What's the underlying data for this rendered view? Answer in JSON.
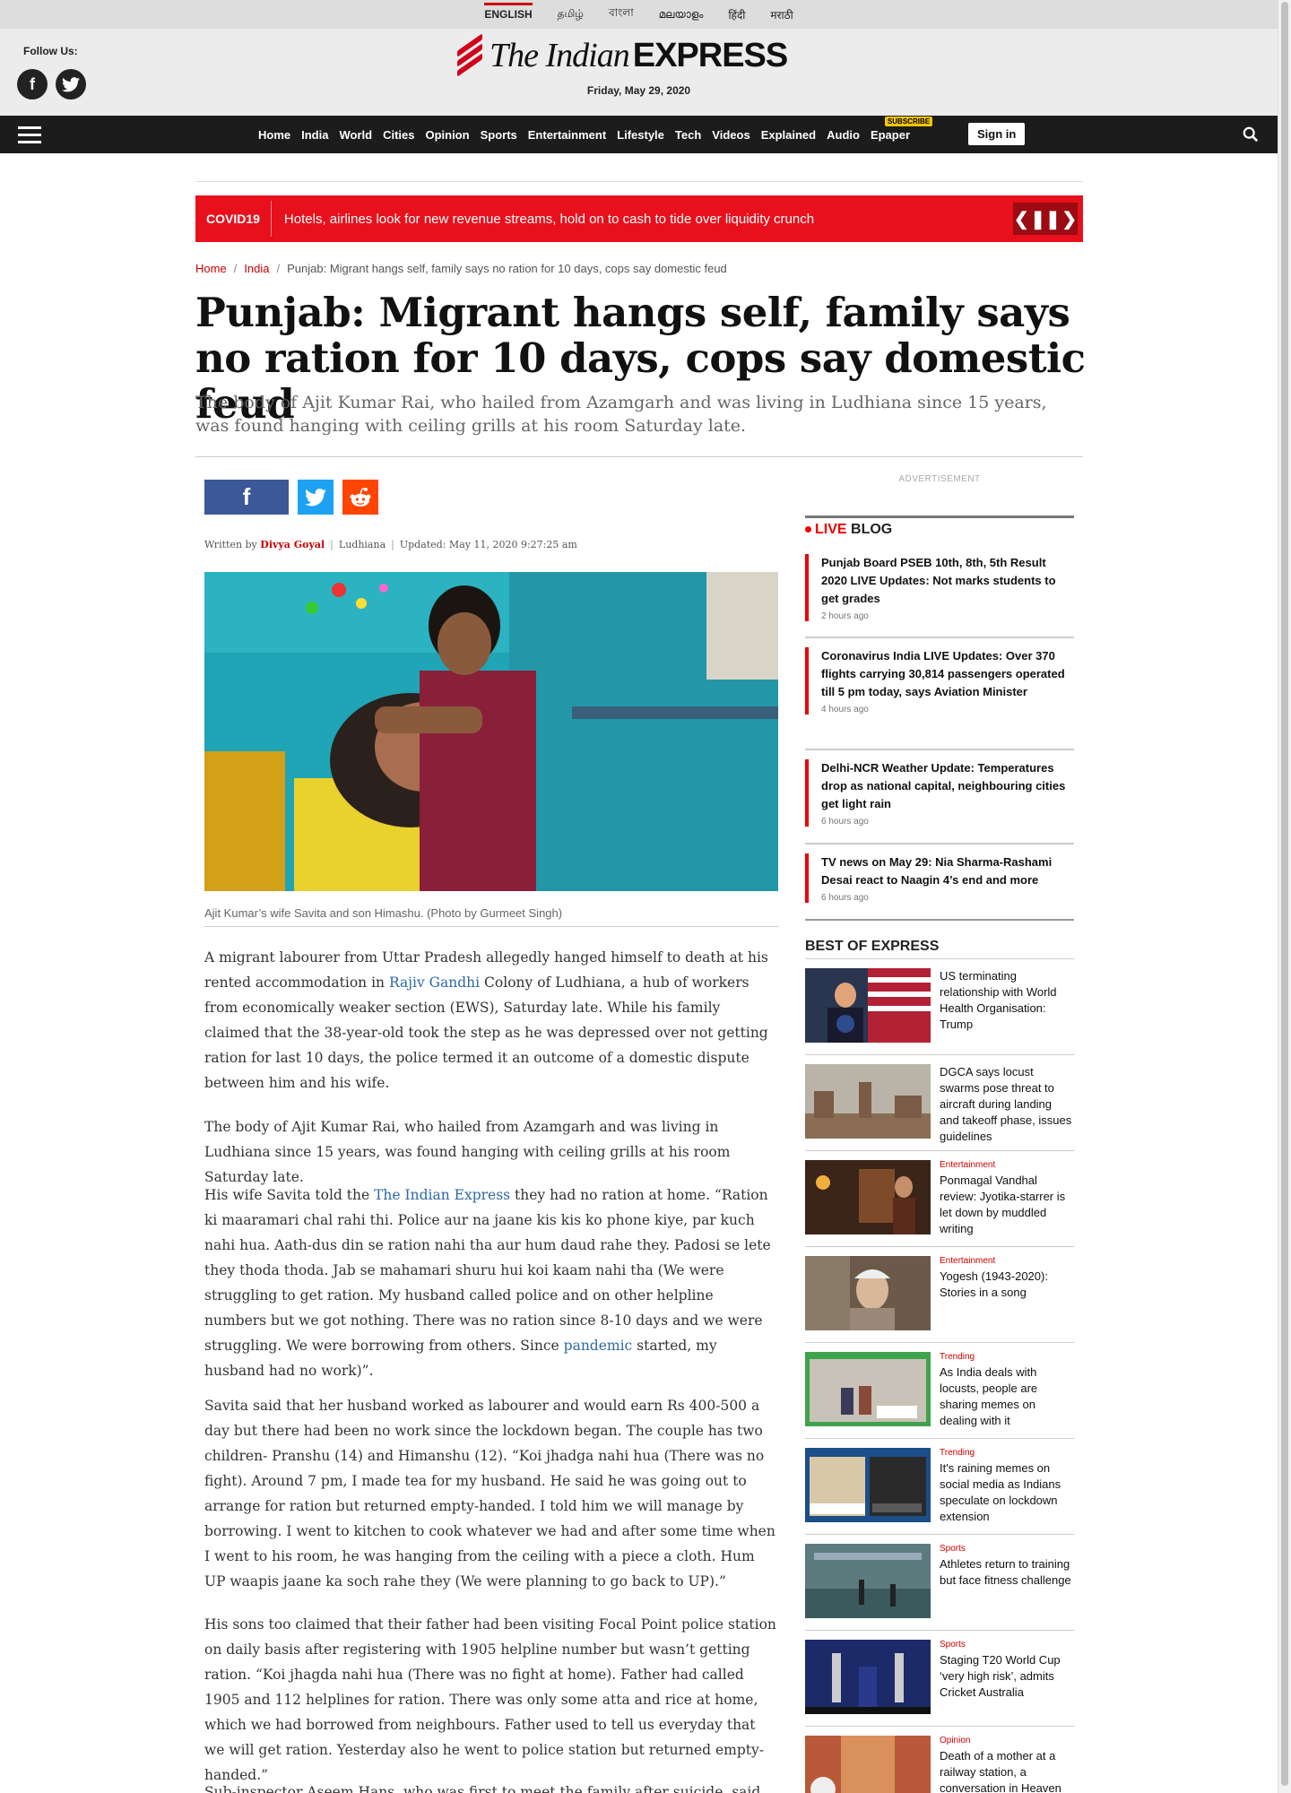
{
  "languages": [
    "ENGLISH",
    "தமிழ்",
    "বাংলা",
    "മലയാളം",
    "हिंदी",
    "मराठी"
  ],
  "masthead": {
    "follow_us": "Follow Us:",
    "facebook_glyph": "f",
    "logo_the": "The Indian",
    "logo_express": "EXPRESS",
    "date": "Friday, May 29, 2020"
  },
  "nav": {
    "items": [
      "Home",
      "India",
      "World",
      "Cities",
      "Opinion",
      "Sports",
      "Entertainment",
      "Lifestyle",
      "Tech",
      "Videos",
      "Explained",
      "Audio",
      "Epaper"
    ],
    "subscribe_badge": "SUBSCRIBE",
    "sign_in": "Sign in"
  },
  "ticker": {
    "tag": "COVID19",
    "headline": "Hotels, airlines look for new revenue streams, hold on to cash to tide over liquidity crunch",
    "controls": [
      "❮",
      "❚❚",
      "❯"
    ]
  },
  "breadcrumb": [
    "Home",
    "India",
    "Punjab: Migrant hangs self, family says no ration for 10 days, cops say domestic feud"
  ],
  "article": {
    "title": "Punjab: Migrant hangs self, family says no ration for 10 days, cops say domestic feud",
    "synopsis": "The body of Ajit Kumar Rai, who hailed from Azamgarh and was living in Ludhiana since 15 years, was found hanging with ceiling grills at his room Saturday late.",
    "share_fb": "f",
    "byline_prefix": "Written by",
    "author": "Divya Goyal",
    "location": "Ludhiana",
    "updated": "Updated: May 11, 2020 9:27:25 am",
    "caption": "Ajit Kumar’s wife Savita and son Himashu. (Photo by Gurmeet Singh)",
    "p1_a": "A migrant labourer from Uttar Pradesh allegedly hanged himself to death at his rented accommodation in ",
    "p1_link": "Rajiv Gandhi",
    "p1_b": " Colony of Ludhiana, a hub of workers from economically weaker section (EWS), Saturday late. While his family claimed that the 38-year-old took the step as he was depressed over not getting ration for last 10 days, the police termed it an outcome of a domestic dispute between him and his wife.",
    "p2": "The body of Ajit Kumar Rai, who hailed from Azamgarh and was living in Ludhiana since 15 years, was found hanging with ceiling grills at his room Saturday late.",
    "p3_a": "His wife Savita told the ",
    "p3_link": "The Indian Express",
    "p3_b": " they had no ration at home. “Ration ki maaramari chal rahi thi. Police aur na jaane kis kis ko phone kiye, par kuch nahi hua. Aath-dus din se ration nahi tha aur hum daud rahe they. Padosi se lete they thoda thoda. Jab se mahamari shuru hui koi kaam nahi tha (We were struggling to get ration. My husband called police and on other helpline numbers but we got nothing. There was no ration since 8-10 days and we were struggling. We were borrowing from others. Since ",
    "p3_link2": "pandemic",
    "p3_c": " started, my husband had no work)”.",
    "p4": "Savita said that her husband worked as labourer and would earn Rs 400-500 a day but there had been no work since the lockdown began. The couple has two children- Pranshu (14) and Himanshu (12). “Koi jhadga nahi hua (There was no fight). Around 7 pm, I made tea for my husband. He said he was going out to arrange for ration but returned empty-handed. I told him we will manage by borrowing. I went to kitchen to cook whatever we had and after some time when I went to his room, he was hanging from the ceiling with a piece a cloth. Hum UP waapis jaane ka soch rahe they (We were planning to go back to UP).”",
    "p5": "His sons too claimed that their father had been visiting Focal Point police station on daily basis after registering with 1905 helpline number but wasn’t getting ration. “Koi jhagda nahi hua (There was no fight at home). Father had called 1905 and 112 helplines for ration. There was only some atta and rice at home, which we had borrowed from neighbours. Father used to tell us everyday that we will get ration. Yesterday also he went to police station but returned empty-handed.”",
    "p6": "Sub-inspector Aseem Hans, who was first to meet the family after suicide, said that"
  },
  "sidebar": {
    "advertisement": "ADVERTISEMENT",
    "live_label": "LIVE",
    "blog_label": "BLOG",
    "live_items": [
      {
        "title": "Punjab Board PSEB 10th, 8th, 5th Result 2020 LIVE Updates: Not marks students to get grades",
        "time": "2 hours ago"
      },
      {
        "title": "Coronavirus India LIVE Updates: Over 370 flights carrying 30,814 passengers operated till 5 pm today, says Aviation Minister",
        "time": "4 hours ago"
      },
      {
        "title": "Delhi-NCR Weather Update: Temperatures drop as national capital, neighbouring cities get light rain",
        "time": "6 hours ago"
      },
      {
        "title": "TV news on May 29: Nia Sharma-Rashami Desai react to Naagin 4’s end and more",
        "time": "6 hours ago"
      }
    ],
    "best_title": "BEST OF EXPRESS",
    "best_items": [
      {
        "category": "",
        "title": "US terminating relationship with World Health Organisation: Trump"
      },
      {
        "category": "",
        "title": "DGCA says locust swarms pose threat to aircraft during landing and takeoff phase, issues guidelines"
      },
      {
        "category": "Entertainment",
        "title": "Ponmagal Vandhal review: Jyotika-starrer is let down by muddled writing"
      },
      {
        "category": "Entertainment",
        "title": "Yogesh (1943-2020): Stories in a song"
      },
      {
        "category": "Trending",
        "title": "As India deals with locusts, people are sharing memes on dealing with it"
      },
      {
        "category": "Trending",
        "title": "It's raining memes on social media as Indians speculate on lockdown extension"
      },
      {
        "category": "Sports",
        "title": "Athletes return to training but face fitness challenge"
      },
      {
        "category": "Sports",
        "title": "Staging T20 World Cup ‘very high risk’, admits Cricket Australia"
      },
      {
        "category": "Opinion",
        "title": "Death of a mother at a railway station, a conversation in Heaven"
      }
    ]
  }
}
